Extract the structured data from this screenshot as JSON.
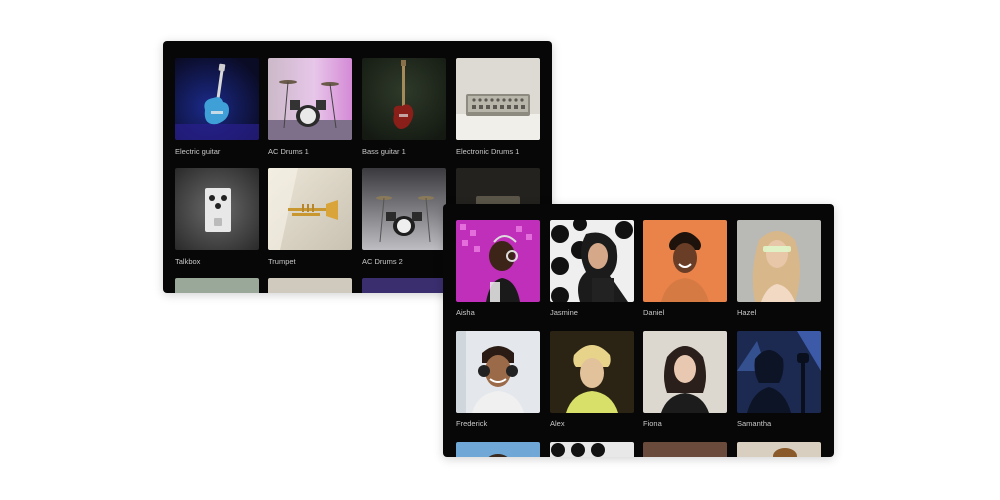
{
  "instruments": {
    "items": [
      {
        "label": "Electric guitar",
        "icon": "electric-guitar-image"
      },
      {
        "label": "AC Drums 1",
        "icon": "drum-kit-image"
      },
      {
        "label": "Bass guitar 1",
        "icon": "bass-guitar-image"
      },
      {
        "label": "Electronic Drums 1",
        "icon": "drum-machine-image"
      },
      {
        "label": "Talkbox",
        "icon": "talkbox-pedal-image"
      },
      {
        "label": "Trumpet",
        "icon": "trumpet-image"
      },
      {
        "label": "AC Drums 2",
        "icon": "drum-kit-image"
      },
      {
        "label": "",
        "icon": "device-image"
      }
    ]
  },
  "voices": {
    "items": [
      {
        "label": "Aisha",
        "icon": "singer-portrait-image"
      },
      {
        "label": "Jasmine",
        "icon": "singer-portrait-image"
      },
      {
        "label": "Daniel",
        "icon": "singer-portrait-image"
      },
      {
        "label": "Hazel",
        "icon": "singer-portrait-image"
      },
      {
        "label": "Frederick",
        "icon": "singer-portrait-image"
      },
      {
        "label": "Alex",
        "icon": "singer-portrait-image"
      },
      {
        "label": "Fiona",
        "icon": "singer-portrait-image"
      },
      {
        "label": "Samantha",
        "icon": "singer-portrait-image"
      }
    ]
  },
  "colors": {
    "panel_background": "#070707",
    "label_text": "#c8c8c8",
    "page_background": "#ffffff"
  }
}
